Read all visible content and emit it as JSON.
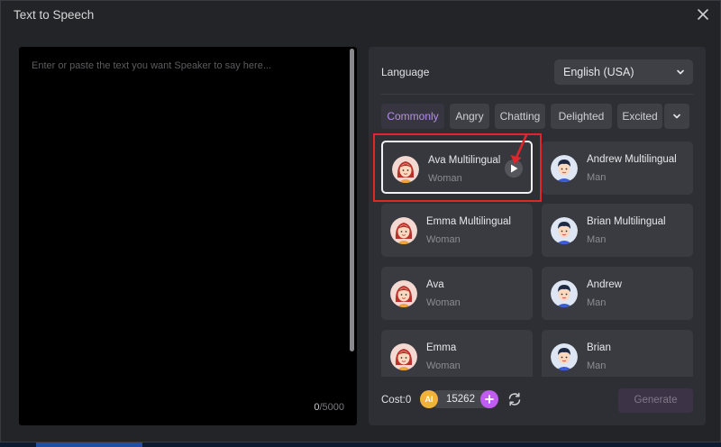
{
  "window": {
    "title": "Text to Speech"
  },
  "editor": {
    "placeholder": "Enter or paste the text you want Speaker to say here...",
    "char_count": "0",
    "char_limit": "/5000"
  },
  "language": {
    "label": "Language",
    "selected": "English (USA)"
  },
  "tabs": [
    {
      "label": "Commonly",
      "active": true
    },
    {
      "label": "Angry"
    },
    {
      "label": "Chatting"
    },
    {
      "label": "Delighted"
    },
    {
      "label": "Excited"
    }
  ],
  "voices": [
    {
      "name": "Ava Multilingual",
      "gender": "Woman",
      "selected": true
    },
    {
      "name": "Andrew Multilingual",
      "gender": "Man"
    },
    {
      "name": "Emma Multilingual",
      "gender": "Woman"
    },
    {
      "name": "Brian Multilingual",
      "gender": "Man"
    },
    {
      "name": "Ava",
      "gender": "Woman"
    },
    {
      "name": "Andrew",
      "gender": "Man"
    },
    {
      "name": "Emma",
      "gender": "Woman"
    },
    {
      "name": "Brian",
      "gender": "Man"
    }
  ],
  "footer": {
    "cost_label": "Cost:",
    "cost_value": "0",
    "coin_label": "AI",
    "credits": "15262",
    "generate_label": "Generate"
  },
  "colors": {
    "accent": "#b68cf0",
    "plus_button": "#c05cf0",
    "highlight": "#e0262a",
    "coin": "#f0b23a"
  },
  "icons": {
    "close": "close-icon",
    "dropdown": "chevron-down-icon",
    "play": "play-icon",
    "plus": "plus-icon",
    "refresh": "refresh-icon"
  }
}
